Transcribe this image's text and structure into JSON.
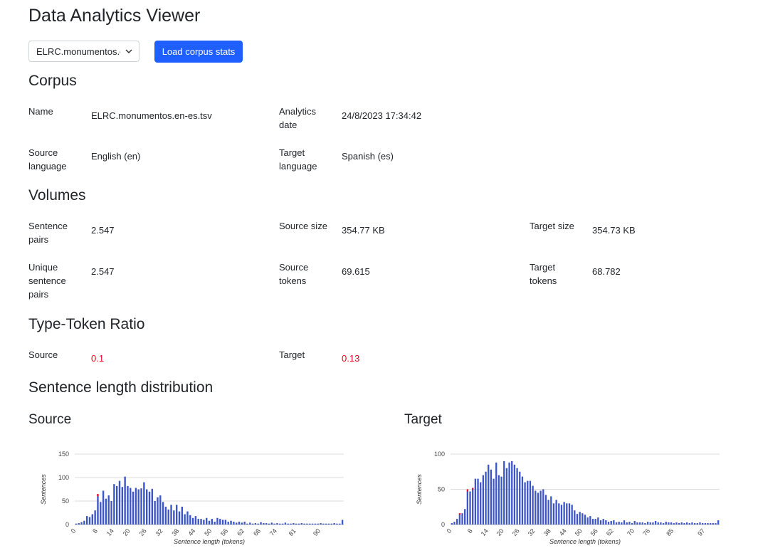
{
  "app": {
    "title": "Data Analytics Viewer"
  },
  "controls": {
    "corpus_select_value": "ELRC.monumentos.en-es.tsv",
    "load_button_label": "Load corpus stats"
  },
  "corpus": {
    "heading": "Corpus",
    "name_label": "Name",
    "name_value": "ELRC.monumentos.en-es.tsv",
    "date_label": "Analytics date",
    "date_value": "24/8/2023 17:34:42",
    "source_lang_label": "Source language",
    "source_lang_value": "English (en)",
    "target_lang_label": "Target language",
    "target_lang_value": "Spanish (es)"
  },
  "volumes": {
    "heading": "Volumes",
    "sentence_pairs_label": "Sentence pairs",
    "sentence_pairs_value": "2.547",
    "source_size_label": "Source size",
    "source_size_value": "354.77 KB",
    "target_size_label": "Target size",
    "target_size_value": "354.73 KB",
    "unique_pairs_label": "Unique sentence pairs",
    "unique_pairs_value": "2.547",
    "source_tokens_label": "Source tokens",
    "source_tokens_value": "69.615",
    "target_tokens_label": "Target tokens",
    "target_tokens_value": "68.782"
  },
  "ttr": {
    "heading": "Type-Token Ratio",
    "source_label": "Source",
    "source_value": "0.1",
    "target_label": "Target",
    "target_value": "0.13",
    "value_color": "#e8001c"
  },
  "distribution": {
    "heading": "Sentence length distribution",
    "source_heading": "Source",
    "target_heading": "Target"
  },
  "chart_data": [
    {
      "type": "bar",
      "ylabel": "Sentences",
      "xlabel": "Sentence length (tokens)",
      "ylim": [
        0,
        150
      ],
      "yticks": [
        0,
        50,
        100,
        150
      ],
      "grid": true,
      "bar_color": "#3c55c6",
      "highlight_color": "#e8001c",
      "x_tick_labels": [
        {
          "x": 0,
          "label": "0"
        },
        {
          "x": 8,
          "label": "8"
        },
        {
          "x": 14,
          "label": "14"
        },
        {
          "x": 20,
          "label": "20"
        },
        {
          "x": 26,
          "label": "26"
        },
        {
          "x": 32,
          "label": "32"
        },
        {
          "x": 38,
          "label": "38"
        },
        {
          "x": 44,
          "label": "44"
        },
        {
          "x": 50,
          "label": "50"
        },
        {
          "x": 56,
          "label": "56"
        },
        {
          "x": 62,
          "label": "62"
        },
        {
          "x": 68,
          "label": "68"
        },
        {
          "x": 74,
          "label": "74"
        },
        {
          "x": 81,
          "label": "81"
        },
        {
          "x": 90,
          "label": "90"
        }
      ],
      "x": [
        0,
        1,
        2,
        3,
        4,
        5,
        6,
        7,
        8,
        9,
        10,
        11,
        12,
        13,
        14,
        15,
        16,
        17,
        18,
        19,
        20,
        21,
        22,
        23,
        24,
        25,
        26,
        27,
        28,
        29,
        30,
        31,
        32,
        33,
        34,
        35,
        36,
        37,
        38,
        39,
        40,
        41,
        42,
        43,
        44,
        45,
        46,
        47,
        48,
        49,
        50,
        51,
        52,
        53,
        54,
        55,
        56,
        57,
        58,
        59,
        60,
        61,
        62,
        63,
        64,
        65,
        66,
        67,
        68,
        69,
        70,
        71,
        72,
        73,
        74,
        75,
        76,
        77,
        78,
        79,
        80,
        81,
        82,
        83,
        84,
        85,
        86,
        87,
        88,
        89,
        90,
        91,
        92,
        93,
        94,
        95,
        96,
        97,
        98
      ],
      "values": [
        2,
        3,
        5,
        8,
        18,
        16,
        22,
        30,
        60,
        48,
        72,
        55,
        62,
        50,
        86,
        82,
        93,
        80,
        102,
        82,
        78,
        70,
        78,
        75,
        77,
        90,
        75,
        70,
        76,
        50,
        58,
        62,
        48,
        38,
        32,
        42,
        30,
        42,
        28,
        38,
        22,
        28,
        20,
        14,
        18,
        12,
        12,
        10,
        14,
        8,
        12,
        6,
        14,
        12,
        10,
        10,
        6,
        8,
        6,
        4,
        6,
        4,
        6,
        2,
        4,
        2,
        3,
        2,
        5,
        3,
        3,
        2,
        4,
        2,
        3,
        2,
        2,
        4,
        2,
        2,
        3,
        2,
        2,
        3,
        2,
        2,
        2,
        2,
        2,
        2,
        3,
        2,
        2,
        2,
        2,
        3,
        2,
        2,
        10
      ],
      "highlight": [
        {
          "x": 8,
          "value": 5
        }
      ]
    },
    {
      "type": "bar",
      "ylabel": "Sentences",
      "xlabel": "Sentence length (tokens)",
      "ylim": [
        0,
        100
      ],
      "yticks": [
        0,
        50,
        100
      ],
      "grid": true,
      "bar_color": "#3c55c6",
      "highlight_color": "#e8001c",
      "x_tick_labels": [
        {
          "x": 0,
          "label": "0"
        },
        {
          "x": 8,
          "label": "8"
        },
        {
          "x": 14,
          "label": "14"
        },
        {
          "x": 20,
          "label": "20"
        },
        {
          "x": 26,
          "label": "26"
        },
        {
          "x": 32,
          "label": "32"
        },
        {
          "x": 38,
          "label": "38"
        },
        {
          "x": 44,
          "label": "44"
        },
        {
          "x": 50,
          "label": "50"
        },
        {
          "x": 56,
          "label": "56"
        },
        {
          "x": 62,
          "label": "62"
        },
        {
          "x": 70,
          "label": "70"
        },
        {
          "x": 76,
          "label": "76"
        },
        {
          "x": 85,
          "label": "85"
        },
        {
          "x": 97,
          "label": "97"
        }
      ],
      "x": [
        0,
        1,
        2,
        3,
        4,
        5,
        6,
        7,
        8,
        9,
        10,
        11,
        12,
        13,
        14,
        15,
        16,
        17,
        18,
        19,
        20,
        21,
        22,
        23,
        24,
        25,
        26,
        27,
        28,
        29,
        30,
        31,
        32,
        33,
        34,
        35,
        36,
        37,
        38,
        39,
        40,
        41,
        42,
        43,
        44,
        45,
        46,
        47,
        48,
        49,
        50,
        51,
        52,
        53,
        54,
        55,
        56,
        57,
        58,
        59,
        60,
        61,
        62,
        63,
        64,
        65,
        66,
        67,
        68,
        69,
        70,
        71,
        72,
        73,
        74,
        75,
        76,
        77,
        78,
        79,
        80,
        81,
        82,
        83,
        84,
        85,
        86,
        87,
        88,
        89,
        90,
        91,
        92,
        93,
        94,
        95,
        96,
        97,
        98,
        99,
        100,
        101,
        102
      ],
      "values": [
        2,
        4,
        8,
        14,
        16,
        22,
        47,
        47,
        50,
        65,
        65,
        60,
        70,
        75,
        85,
        78,
        65,
        88,
        70,
        68,
        90,
        80,
        88,
        90,
        85,
        80,
        75,
        68,
        60,
        62,
        62,
        55,
        48,
        45,
        48,
        50,
        42,
        35,
        40,
        30,
        35,
        30,
        28,
        32,
        30,
        30,
        28,
        20,
        15,
        18,
        16,
        14,
        10,
        12,
        8,
        8,
        10,
        6,
        8,
        6,
        4,
        5,
        6,
        3,
        4,
        3,
        6,
        3,
        4,
        2,
        5,
        3,
        3,
        3,
        2,
        4,
        3,
        3,
        5,
        3,
        3,
        2,
        4,
        3,
        3,
        2,
        3,
        2,
        3,
        2,
        3,
        2,
        3,
        2,
        2,
        3,
        2,
        2,
        2,
        2,
        2,
        2,
        6
      ],
      "highlight": [
        {
          "x": 3,
          "value": 2
        },
        {
          "x": 6,
          "value": 3
        },
        {
          "x": 8,
          "value": 2
        }
      ]
    }
  ]
}
